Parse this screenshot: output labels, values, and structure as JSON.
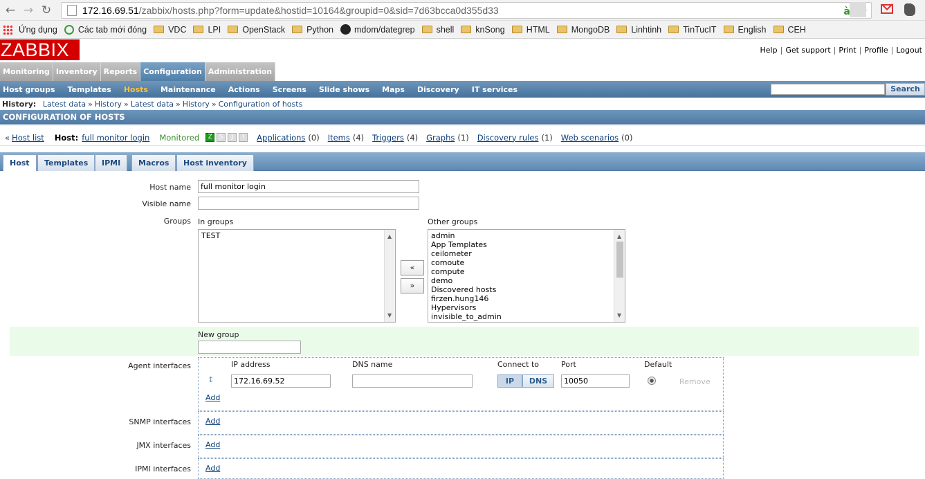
{
  "browser": {
    "url_host": "172.16.69.51",
    "url_path": "/zabbix/hosts.php?form=update&hostid=10164&groupid=0&sid=7d63bcca0d355d33"
  },
  "bookmarks": [
    {
      "label": "Ứng dụng",
      "icon": "apps-icon"
    },
    {
      "label": "Các tab mới đóng",
      "icon": "history-icon"
    },
    {
      "label": "VDC",
      "icon": "folder-icon"
    },
    {
      "label": "LPI",
      "icon": "folder-icon"
    },
    {
      "label": "OpenStack",
      "icon": "folder-icon"
    },
    {
      "label": "Python",
      "icon": "folder-icon"
    },
    {
      "label": "mdom/dategrep",
      "icon": "github-icon"
    },
    {
      "label": "shell",
      "icon": "folder-icon"
    },
    {
      "label": "knSong",
      "icon": "folder-icon"
    },
    {
      "label": "HTML",
      "icon": "folder-icon"
    },
    {
      "label": "MongoDB",
      "icon": "folder-icon"
    },
    {
      "label": "Linhtinh",
      "icon": "folder-icon"
    },
    {
      "label": "TinTucIT",
      "icon": "folder-icon"
    },
    {
      "label": "English",
      "icon": "folder-icon"
    },
    {
      "label": "CEH",
      "icon": "folder-icon"
    }
  ],
  "logo": "ZABBIX",
  "toplinks": [
    "Help",
    "Get support",
    "Print",
    "Profile",
    "Logout"
  ],
  "mainmenu": [
    "Monitoring",
    "Inventory",
    "Reports",
    "Configuration",
    "Administration"
  ],
  "submenu": [
    "Host groups",
    "Templates",
    "Hosts",
    "Maintenance",
    "Actions",
    "Screens",
    "Slide shows",
    "Maps",
    "Discovery",
    "IT services"
  ],
  "search": {
    "button": "Search"
  },
  "history": {
    "label": "History:",
    "items": [
      "Latest data",
      "History",
      "Latest data",
      "History",
      "Configuration of hosts"
    ]
  },
  "page_title": "CONFIGURATION OF HOSTS",
  "hostbar": {
    "prefix": "«",
    "host_list": "Host list",
    "host_label": "Host:",
    "host_name": "full monitor login",
    "status": "Monitored",
    "avail": [
      "Z",
      "S",
      "J",
      "I"
    ],
    "links": [
      {
        "label": "Applications",
        "count": "(0)"
      },
      {
        "label": "Items",
        "count": "(4)"
      },
      {
        "label": "Triggers",
        "count": "(4)"
      },
      {
        "label": "Graphs",
        "count": "(1)"
      },
      {
        "label": "Discovery rules",
        "count": "(1)"
      },
      {
        "label": "Web scenarios",
        "count": "(0)"
      }
    ]
  },
  "tabs": [
    "Host",
    "Templates",
    "IPMI",
    "Macros",
    "Host inventory"
  ],
  "form": {
    "host_name_label": "Host name",
    "host_name": "full monitor login",
    "visible_name_label": "Visible name",
    "visible_name": "",
    "groups_label": "Groups",
    "in_groups_label": "In groups",
    "other_groups_label": "Other groups",
    "in_groups": [
      "TEST"
    ],
    "other_groups": [
      "admin",
      "App Templates",
      "ceilometer",
      "comoute",
      "compute",
      "demo",
      "Discovered hosts",
      "firzen.hung146",
      "Hypervisors",
      "invisible_to_admin"
    ],
    "move_left": "«",
    "move_right": "»",
    "new_group_label": "New group",
    "new_group": "",
    "agent_label": "Agent interfaces",
    "ip_header": "IP address",
    "dns_header": "DNS name",
    "connect_header": "Connect to",
    "port_header": "Port",
    "default_header": "Default",
    "ip": "172.16.69.52",
    "dns": "",
    "connect_ip": "IP",
    "connect_dns": "DNS",
    "port": "10050",
    "remove": "Remove",
    "add": "Add",
    "snmp_label": "SNMP interfaces",
    "jmx_label": "JMX interfaces",
    "ipmi_label": "IPMI interfaces"
  }
}
